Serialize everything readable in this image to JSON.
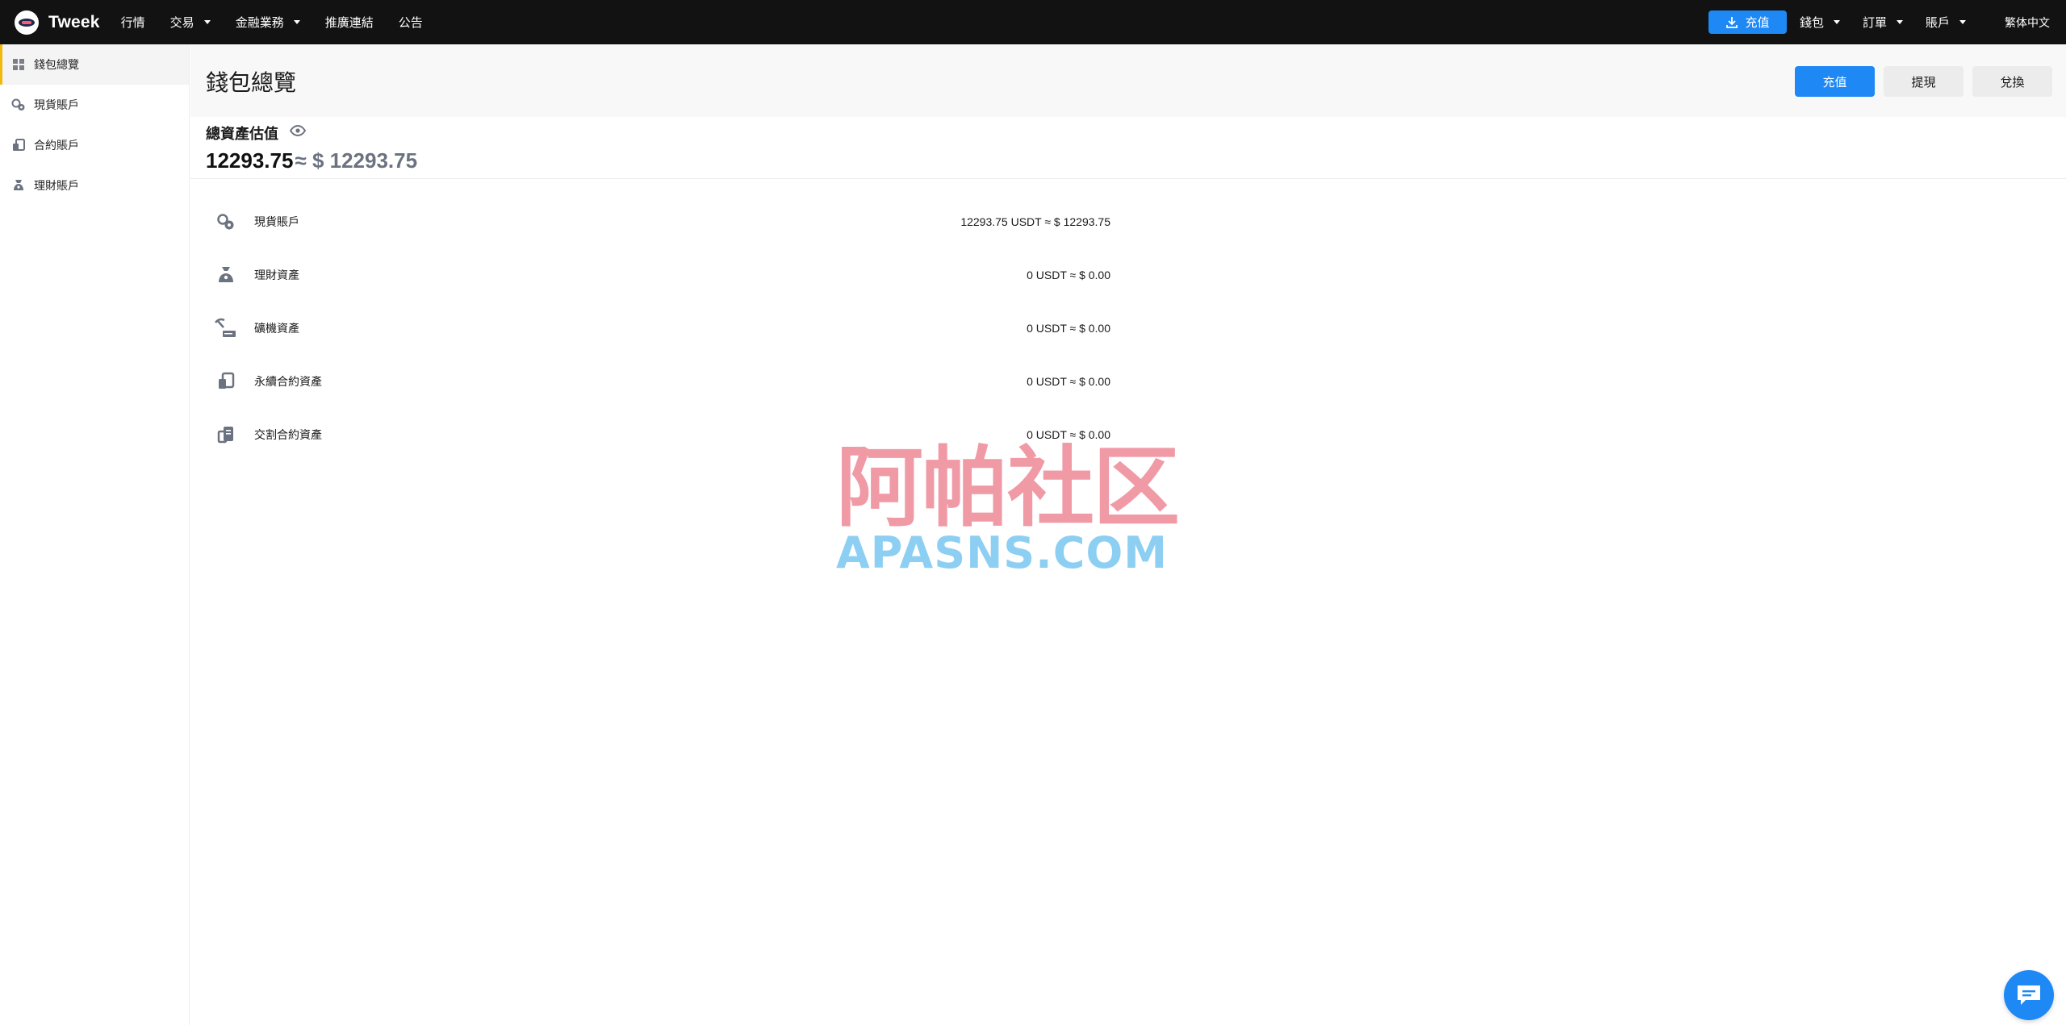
{
  "app": {
    "name": "Tweek"
  },
  "nav": {
    "items": [
      {
        "label": "行情",
        "has_dropdown": false
      },
      {
        "label": "交易",
        "has_dropdown": true
      },
      {
        "label": "金融業務",
        "has_dropdown": true
      },
      {
        "label": "推廣連結",
        "has_dropdown": false
      },
      {
        "label": "公告",
        "has_dropdown": false
      }
    ],
    "deposit_label": "充值",
    "right_menus": [
      "錢包",
      "訂單",
      "賬戶"
    ],
    "language": "繁体中文"
  },
  "sidebar": {
    "items": [
      {
        "label": "錢包總覽",
        "icon": "dashboard-icon",
        "active": true
      },
      {
        "label": "現貨賬戶",
        "icon": "spot-icon",
        "active": false
      },
      {
        "label": "合約賬戶",
        "icon": "contract-icon",
        "active": false
      },
      {
        "label": "理財賬戶",
        "icon": "finance-icon",
        "active": false
      }
    ]
  },
  "header": {
    "title": "錢包總覽",
    "buttons": {
      "deposit": "充值",
      "withdraw": "提現",
      "exchange": "兌換"
    }
  },
  "total": {
    "label": "總資產估值",
    "value": "12293.75",
    "approx": "≈ $ 12293.75"
  },
  "assets": [
    {
      "name": "現貨賬戶",
      "amount": "12293.75 USDT ≈ $ 12293.75",
      "icon": "spot-icon"
    },
    {
      "name": "理財資產",
      "amount": "0 USDT ≈ $ 0.00",
      "icon": "finance-icon"
    },
    {
      "name": "礦機資產",
      "amount": "0 USDT ≈ $ 0.00",
      "icon": "mining-icon"
    },
    {
      "name": "永續合約資產",
      "amount": "0 USDT ≈ $ 0.00",
      "icon": "perpetual-icon"
    },
    {
      "name": "交割合約資產",
      "amount": "0 USDT ≈ $ 0.00",
      "icon": "delivery-icon"
    }
  ],
  "watermark": {
    "cn": "阿帕社区",
    "en": "APASNS.COM"
  },
  "colors": {
    "accent": "#1e88f5",
    "active_marker": "#f0b90b",
    "topbar": "#121212"
  }
}
